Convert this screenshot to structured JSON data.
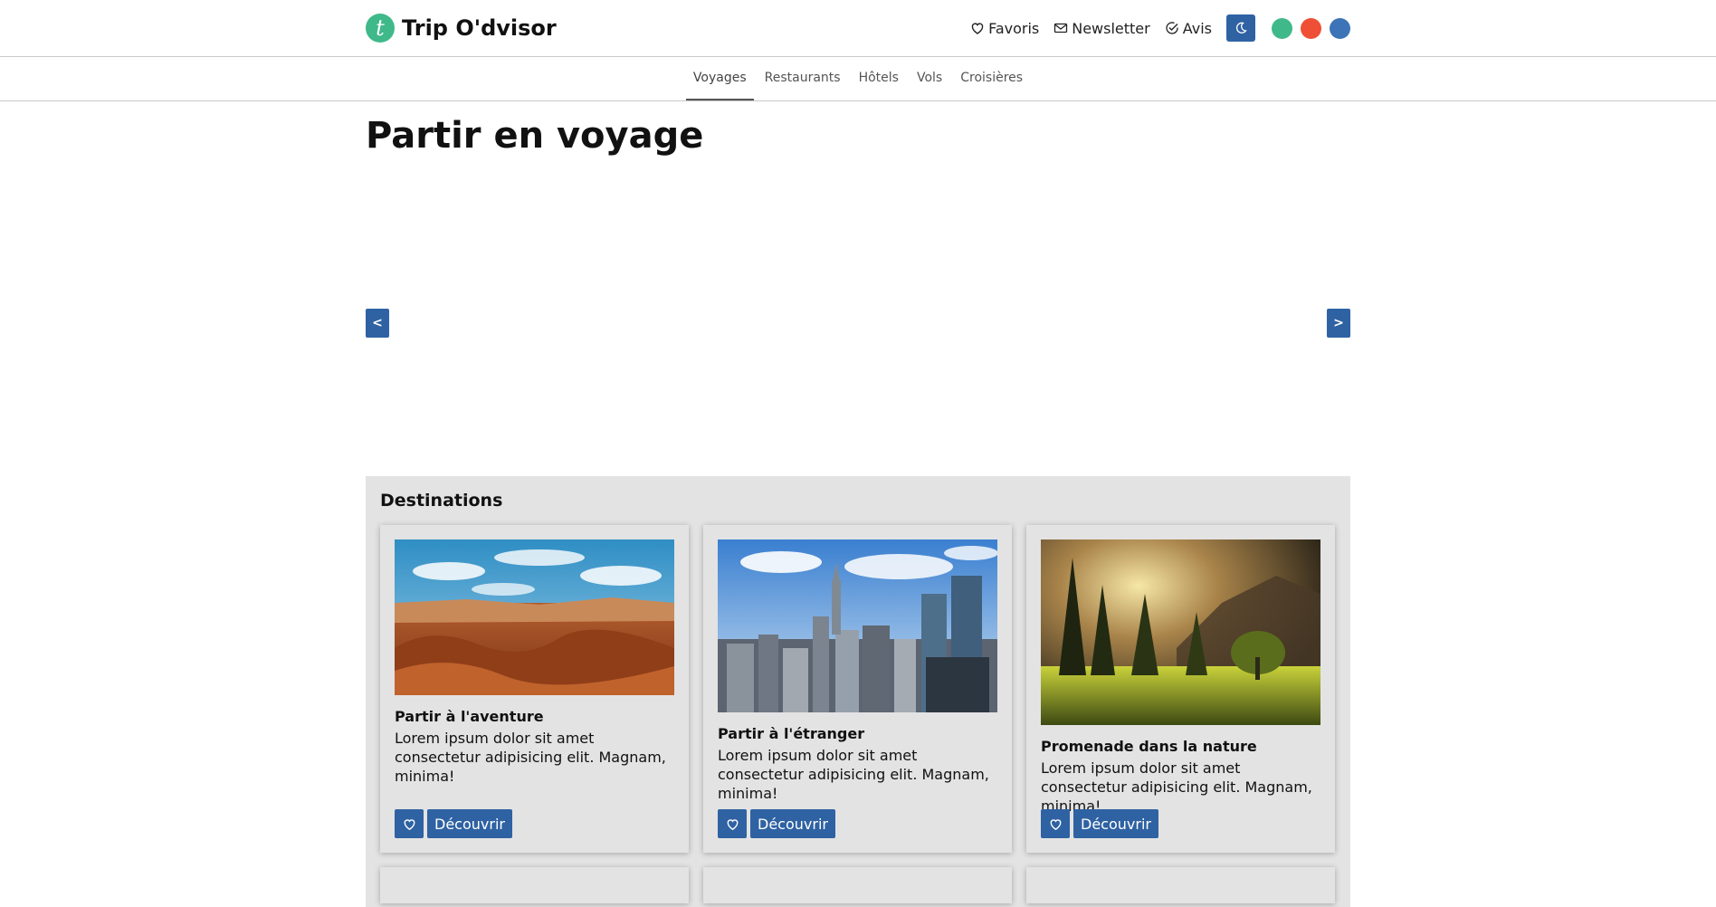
{
  "brand": {
    "logo_letter": "t",
    "name": "Trip O'dvisor",
    "color": "#3fb98a"
  },
  "header": {
    "actions": [
      {
        "label": "Favoris",
        "icon": "heart-icon"
      },
      {
        "label": "Newsletter",
        "icon": "mail-icon"
      },
      {
        "label": "Avis",
        "icon": "check-circle-icon"
      }
    ],
    "theme_toggle_icon": "moon-icon",
    "swatches": [
      "#3fb98a",
      "#ee4f35",
      "#3c74b7"
    ]
  },
  "subnav": {
    "items": [
      "Voyages",
      "Restaurants",
      "Hôtels",
      "Vols",
      "Croisières"
    ],
    "active": "Voyages"
  },
  "main": {
    "title": "Partir en voyage",
    "carousel": {
      "prev_label": "<",
      "next_label": ">"
    }
  },
  "destinations": {
    "heading": "Destinations",
    "cards": [
      {
        "title": "Partir à l'aventure",
        "text": "Lorem ipsum dolor sit amet consectetur adipisicing elit. Magnam, minima!",
        "button": "Découvrir",
        "image": "desert-canyon"
      },
      {
        "title": "Partir à l'étranger",
        "text": "Lorem ipsum dolor sit amet consectetur adipisicing elit. Magnam, minima!",
        "button": "Découvrir",
        "image": "city-skyline"
      },
      {
        "title": "Promenade dans la nature",
        "text": "Lorem ipsum dolor sit amet consectetur adipisicing elit. Magnam, minima!",
        "button": "Découvrir",
        "image": "forest-meadow"
      }
    ]
  },
  "accent_color": "#2f62a3"
}
